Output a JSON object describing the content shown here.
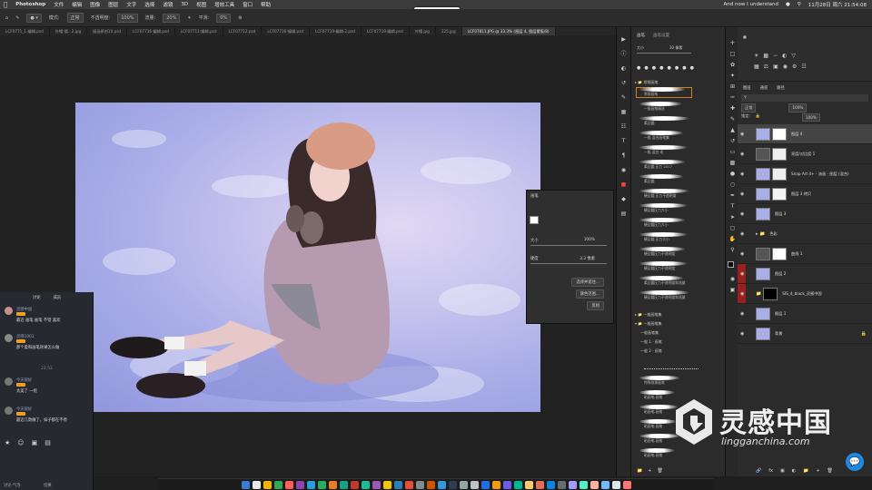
{
  "menubar": {
    "apple": "",
    "app_name": "Photoshop",
    "items": [
      "文件",
      "编辑",
      "图像",
      "图层",
      "文字",
      "选择",
      "滤镜",
      "3D",
      "视图",
      "增效工具",
      "窗口",
      "帮助"
    ],
    "now_playing": "And now I understand",
    "clock": "11月28日 周六 21:54:08"
  },
  "recording_badge": "录制中 01:12:31",
  "options": {
    "mode_label": "模式:",
    "mode_value": "正常",
    "opacity_label": "不透明度:",
    "opacity_value": "100%",
    "flow_label": "流量:",
    "flow_value": "20%",
    "smooth_label": "平滑:",
    "smooth_value": "0%"
  },
  "doc_tabs": [
    "LCF0771_1-编辑.psd",
    "外帽 帽...2.jpg",
    "插画原创10.psd",
    "LCF07716-编辑.psd",
    "LCF07711-编辑.psd",
    "LCF07712.psd",
    "LCF07716-编辑.psd",
    "LCF07719-编辑-2.psd",
    "LCF07719-编辑.psd",
    "外帽.jpg",
    "225.jpg",
    "LCF07811.JPG @ 33.3% (图层 4, 图层蒙版/8)"
  ],
  "brush_settings_panel": {
    "title": "画笔",
    "size_label": "大小",
    "size_value": "100%",
    "hardness_label": "硬度",
    "hardness_value": "3.3 像素",
    "btn_1": "选择并遮住...",
    "btn_2": "颜色范围...",
    "btn_3": "反相"
  },
  "chat": {
    "tab_1": "讨论",
    "tab_2": "成员",
    "messages": [
      {
        "name": "灵感中国",
        "text": "最近 画笔 画笔 不错 喜欢"
      },
      {
        "name": "灵感1001",
        "text": "那个柔和画笔效果怎么做"
      },
      {
        "name": "今天很好",
        "text": "太美了 一组"
      },
      {
        "name": "今天很好",
        "text": "最近几款做了，妹子都在不停"
      }
    ],
    "time_divider": "21:53",
    "footer_label": "讨论·气泡",
    "footer_right": "切换"
  },
  "brushes": {
    "header_tab_1": "画笔",
    "header_tab_2": "画笔设置",
    "size_label": "大小",
    "size_value": "30 像素",
    "groups": [
      "常规画笔",
      "一般画笔集",
      "一般画笔集",
      "墨迹画笔集"
    ],
    "items": [
      "常规画笔",
      "一般画笔精选",
      "柔边圆",
      "一般 混合画笔集",
      "一般 混合 毛",
      "柔边圆 压力 2017",
      "柔边圆",
      "硬边圆 压力不透明度",
      "硬边圆压力大小",
      "硬边圆压力大小",
      "硬边圆 压力大小",
      "硬边圆压力不透明度",
      "硬边圆压力不透明度",
      "柔边圆压力不透明度和流量",
      "硬边圆压力不透明度和流量"
    ],
    "lower_items": [
      "一般画笔集",
      "一般 1 - 画笔",
      "一般 2 - 画笔",
      "特殊效果画笔",
      "粘画笔-画笔",
      "粘画笔-画笔",
      "粘画笔-画笔",
      "粘画笔-画笔",
      "粘画笔-画笔",
      "粘画笔-画笔",
      "粘画笔-画笔"
    ]
  },
  "layers": {
    "panel_tab_1": "图层",
    "panel_tab_2": "通道",
    "panel_tab_3": "路径",
    "blend_mode": "正常",
    "opacity": "100%",
    "fill": "100%",
    "lock_label": "锁定:",
    "rows": [
      {
        "name": "图层 4"
      },
      {
        "name": "亮度/对比度 1"
      },
      {
        "name": "Snap Art 4+ - 油画 - 图层 (混合)"
      },
      {
        "name": "图层 3 拷贝"
      },
      {
        "name": "图层 3"
      },
      {
        "name": "色彩"
      },
      {
        "name": "曲线 1"
      },
      {
        "name": "图层 2"
      },
      {
        "name": "SIS_4_black_灵感中国"
      },
      {
        "name": "图层 1"
      },
      {
        "name": "背景"
      }
    ]
  },
  "watermark": {
    "title": "灵感中国",
    "url": "lingganchina.com"
  },
  "dock_colors": [
    "#3a7bd5",
    "#e8e8e8",
    "#f4b400",
    "#34a853",
    "#ff5f57",
    "#8e44ad",
    "#2d9cdb",
    "#27ae60",
    "#e67e22",
    "#16a085",
    "#c0392b",
    "#1abc9c",
    "#9b59b6",
    "#f1c40f",
    "#2980b9",
    "#e74c3c",
    "#7f8c8d",
    "#d35400",
    "#3498db",
    "#2c3e50",
    "#95a5a6",
    "#bdc3c7",
    "#1f6feb",
    "#f39c12",
    "#6c5ce7",
    "#00b894",
    "#fdcb6e",
    "#e17055",
    "#0984e3",
    "#636e72",
    "#a29bfe",
    "#55efc4",
    "#fab1a0",
    "#74b9ff",
    "#dfe6e9",
    "#ff7675"
  ]
}
